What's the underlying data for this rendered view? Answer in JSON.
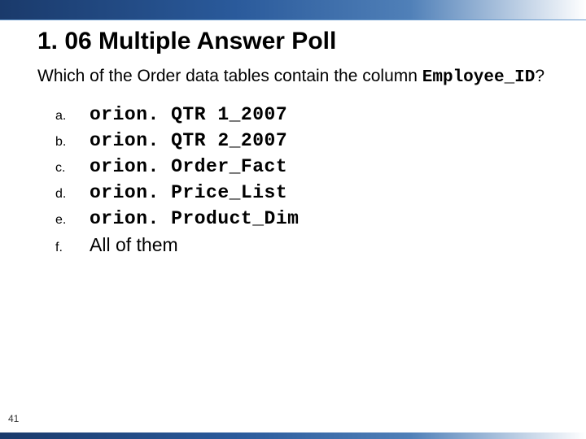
{
  "title": "1. 06 Multiple Answer Poll",
  "question_prefix": "Which of the Order data tables contain the column ",
  "question_code": "Employee_ID",
  "question_suffix": "?",
  "options": [
    {
      "letter": "a.",
      "text": "orion. QTR 1_2007",
      "mono": true
    },
    {
      "letter": "b.",
      "text": "orion. QTR 2_2007",
      "mono": true
    },
    {
      "letter": "c.",
      "text": "orion. Order_Fact",
      "mono": true
    },
    {
      "letter": "d.",
      "text": "orion. Price_List",
      "mono": true
    },
    {
      "letter": "e.",
      "text": "orion. Product_Dim",
      "mono": true
    },
    {
      "letter": "f.",
      "text": "All of them",
      "mono": false
    }
  ],
  "page_number": "41"
}
